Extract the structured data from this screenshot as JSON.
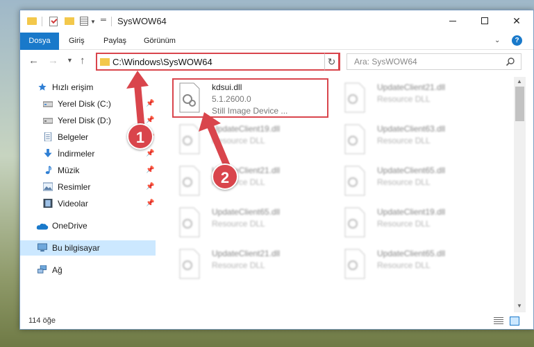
{
  "window": {
    "title": "SysWOW64",
    "minimize": "",
    "maximize": "",
    "close": "✕"
  },
  "ribbon": {
    "tabs": [
      "Dosya",
      "Giriş",
      "Paylaş",
      "Görünüm"
    ],
    "help": "?"
  },
  "address": {
    "path": "C:\\Windows\\SysWOW64",
    "search_placeholder": "Ara: SysWOW64"
  },
  "sidebar": {
    "items": [
      {
        "label": "Hızlı erişim",
        "icon": "star-icon",
        "pinned": false
      },
      {
        "label": "Yerel Disk (C:)",
        "icon": "drive-icon",
        "pinned": true
      },
      {
        "label": "Yerel Disk (D:)",
        "icon": "drive-icon",
        "pinned": true
      },
      {
        "label": "Belgeler",
        "icon": "documents-icon",
        "pinned": true
      },
      {
        "label": "İndirmeler",
        "icon": "download-icon",
        "pinned": true
      },
      {
        "label": "Müzik",
        "icon": "music-icon",
        "pinned": true
      },
      {
        "label": "Resimler",
        "icon": "pictures-icon",
        "pinned": true
      },
      {
        "label": "Videolar",
        "icon": "videos-icon",
        "pinned": true
      },
      {
        "label": "OneDrive",
        "icon": "cloud-icon",
        "pinned": false
      },
      {
        "label": "Bu bilgisayar",
        "icon": "computer-icon",
        "pinned": false,
        "selected": true
      },
      {
        "label": "Ağ",
        "icon": "network-icon",
        "pinned": false
      }
    ]
  },
  "files": [
    {
      "name": "kdsui.dll",
      "version": "5.1.2600.0",
      "desc": "Still Image Device ...",
      "highlighted": true
    },
    {
      "name": "UpdateClient21.dll",
      "desc": "Resource DLL"
    },
    {
      "name": "UpdateClient19.dll",
      "desc": "Resource DLL"
    },
    {
      "name": "UpdateClient63.dll",
      "desc": "Resource DLL"
    },
    {
      "name": "UpdateClient21.dll",
      "desc": "Resource DLL"
    },
    {
      "name": "UpdateClient65.dll",
      "desc": "Resource DLL"
    },
    {
      "name": "UpdateClient65.dll",
      "desc": "Resource DLL"
    },
    {
      "name": "UpdateClient19.dll",
      "desc": "Resource DLL"
    },
    {
      "name": "UpdateClient21.dll",
      "desc": "Resource DLL"
    },
    {
      "name": "UpdateClient65.dll",
      "desc": "Resource DLL"
    }
  ],
  "status": {
    "count": "114 öğe"
  },
  "annotations": {
    "step1": "1",
    "step2": "2",
    "color": "#d9454c"
  },
  "colors": {
    "accent": "#1979ca",
    "selection": "#cce8ff",
    "highlight": "#d9454c"
  }
}
